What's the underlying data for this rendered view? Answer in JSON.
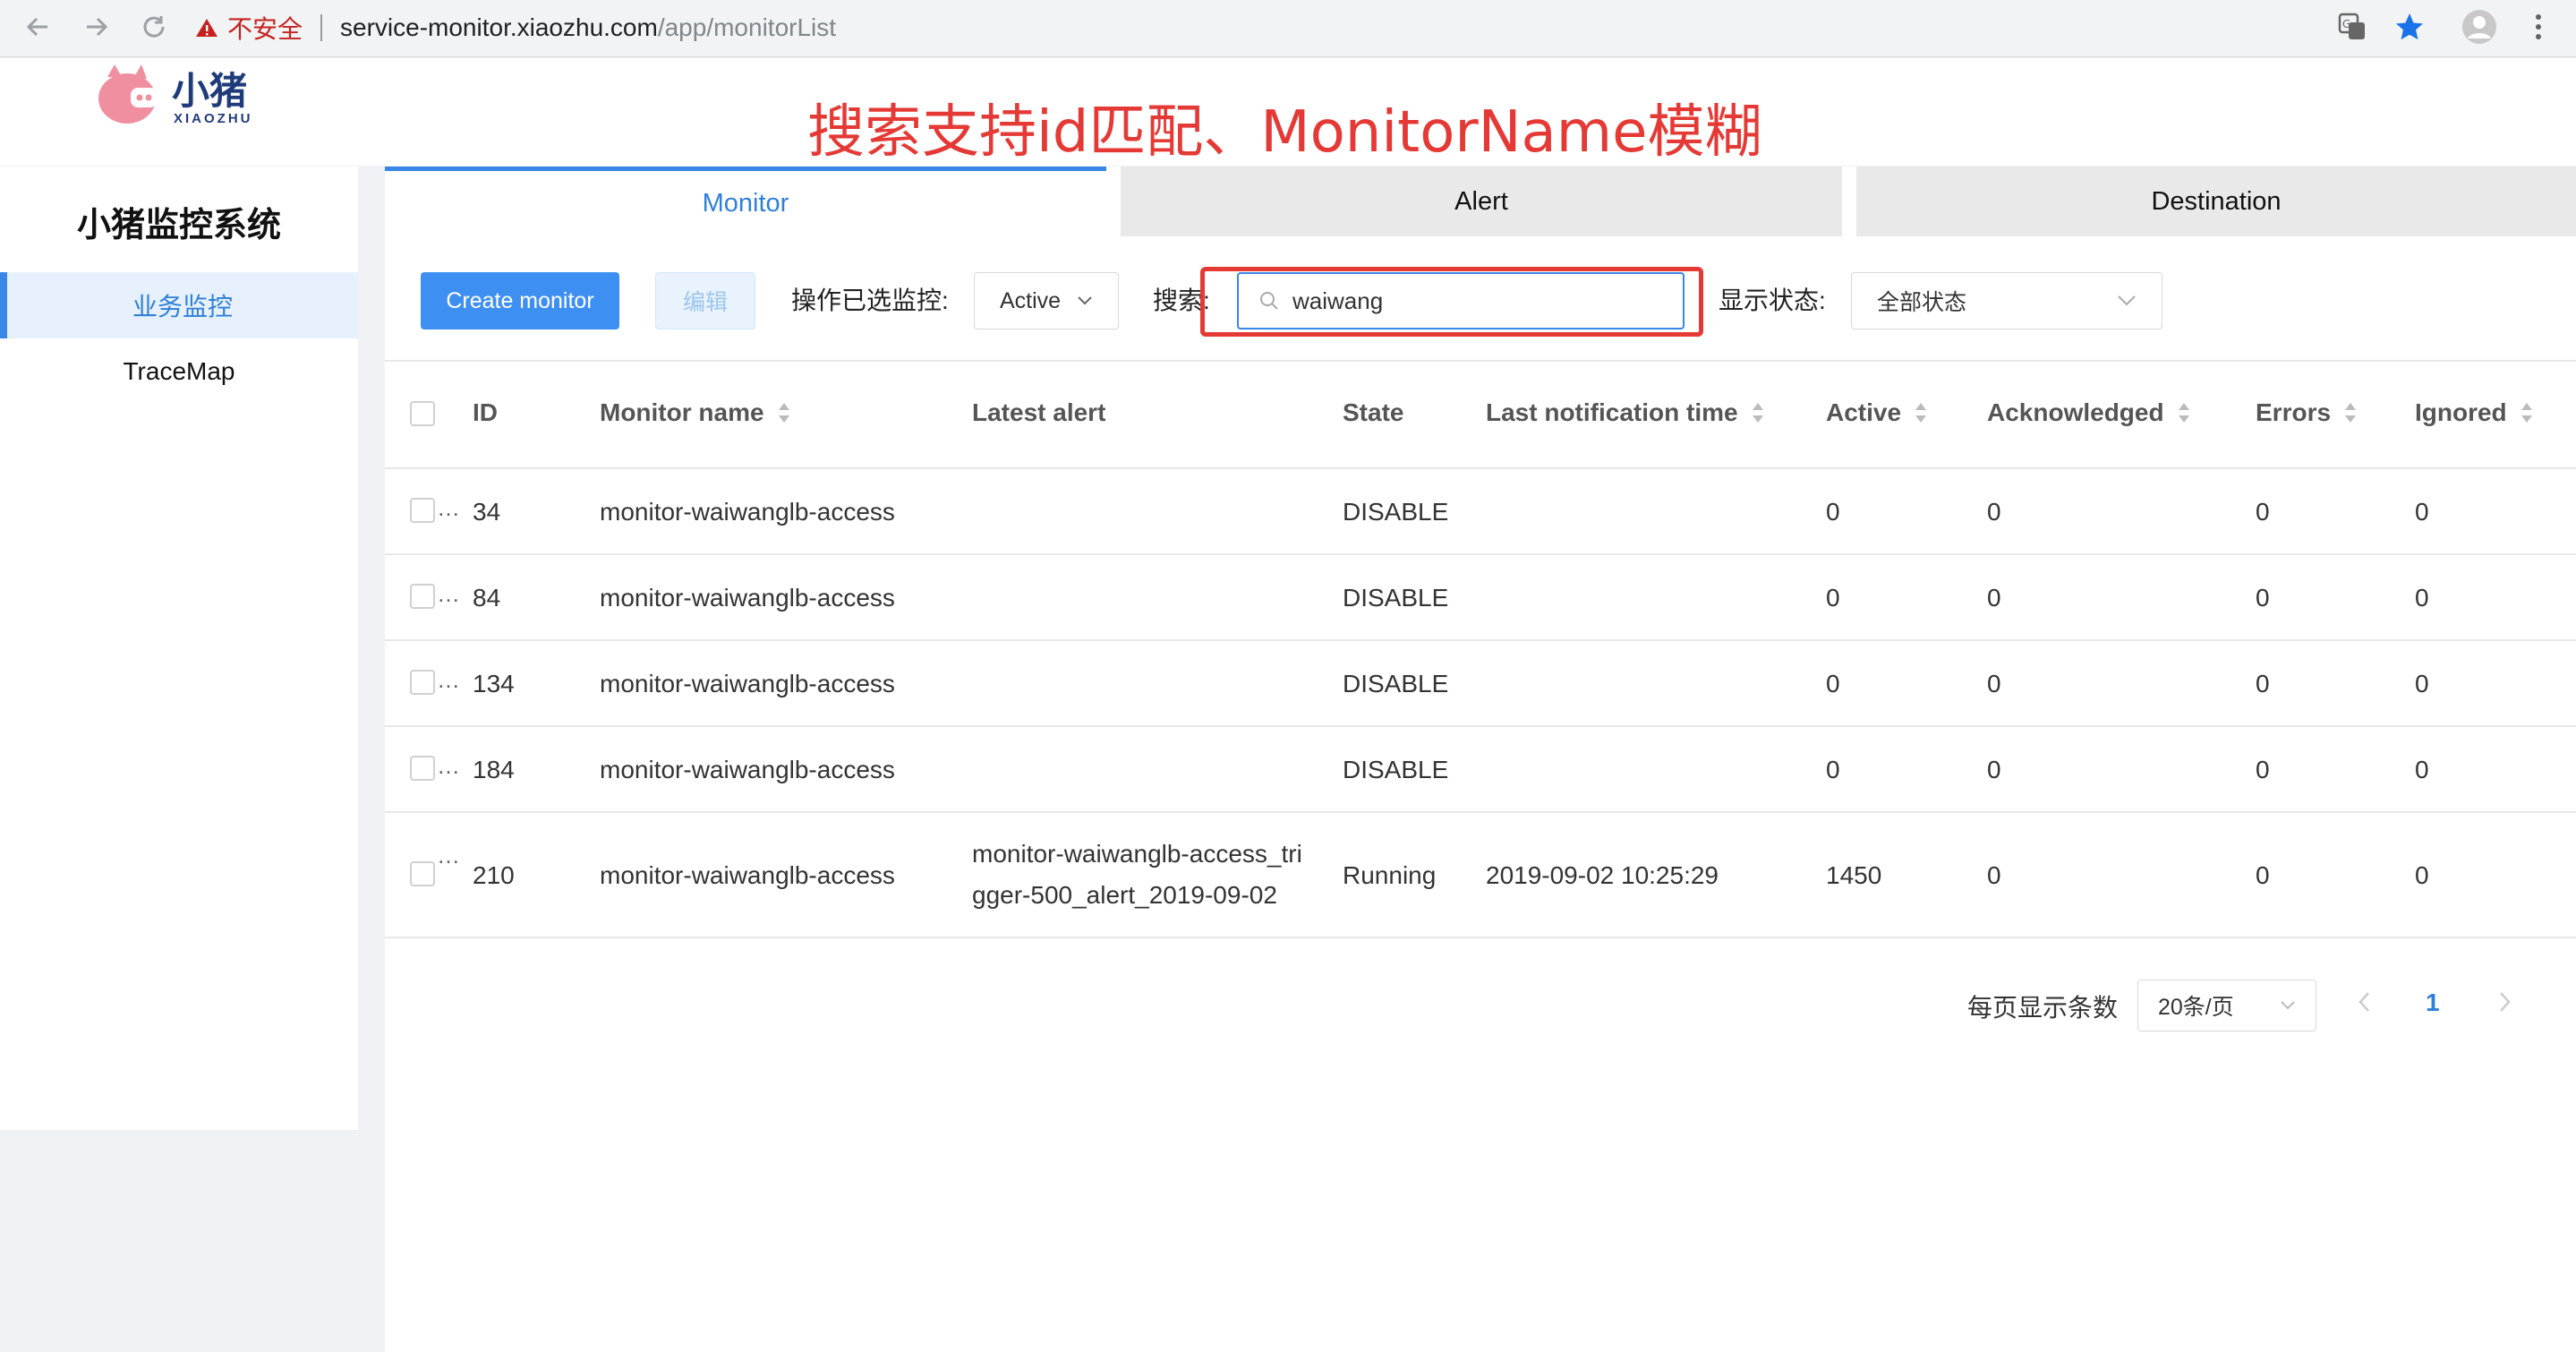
{
  "browser": {
    "security_label": "不安全",
    "url_host": "service-monitor.xiaozhu.com",
    "url_path": "/app/monitorList"
  },
  "logo": {
    "name": "小猪",
    "sub": "XIAOZHU"
  },
  "annotation": "搜索支持id匹配、MonitorName模糊",
  "sidebar": {
    "title": "小猪监控系统",
    "items": [
      {
        "label": "业务监控",
        "active": true
      },
      {
        "label": "TraceMap",
        "active": false
      }
    ]
  },
  "tabs": [
    {
      "label": "Monitor",
      "active": true
    },
    {
      "label": "Alert",
      "active": false
    },
    {
      "label": "Destination",
      "active": false
    }
  ],
  "toolbar": {
    "create_label": "Create monitor",
    "edit_label": "编辑",
    "bulk_label": "操作已选监控:",
    "bulk_value": "Active",
    "search_label": "搜索:",
    "search_value": "waiwang",
    "status_label": "显示状态:",
    "status_value": "全部状态"
  },
  "table": {
    "columns": [
      "ID",
      "Monitor name",
      "Latest alert",
      "State",
      "Last notification time",
      "Active",
      "Acknowledged",
      "Errors",
      "Ignored"
    ],
    "sortable": [
      true,
      true,
      false,
      false,
      true,
      true,
      true,
      true,
      true
    ],
    "rows": [
      {
        "id": "34",
        "name": "monitor-waiwanglb-access",
        "alert_line1": "",
        "alert_line2": "",
        "state": "DISABLE",
        "last_time": "",
        "active": "0",
        "ack": "0",
        "errors": "0",
        "ignored": "0"
      },
      {
        "id": "84",
        "name": "monitor-waiwanglb-access",
        "alert_line1": "",
        "alert_line2": "",
        "state": "DISABLE",
        "last_time": "",
        "active": "0",
        "ack": "0",
        "errors": "0",
        "ignored": "0"
      },
      {
        "id": "134",
        "name": "monitor-waiwanglb-access",
        "alert_line1": "",
        "alert_line2": "",
        "state": "DISABLE",
        "last_time": "",
        "active": "0",
        "ack": "0",
        "errors": "0",
        "ignored": "0"
      },
      {
        "id": "184",
        "name": "monitor-waiwanglb-access",
        "alert_line1": "",
        "alert_line2": "",
        "state": "DISABLE",
        "last_time": "",
        "active": "0",
        "ack": "0",
        "errors": "0",
        "ignored": "0"
      },
      {
        "id": "210",
        "name": "monitor-waiwanglb-access",
        "alert_line1": "monitor-waiwanglb-access_tri",
        "alert_line2": "gger-500_alert_2019-09-02",
        "state": "Running",
        "last_time": "2019-09-02 10:25:29",
        "active": "1450",
        "ack": "0",
        "errors": "0",
        "ignored": "0"
      }
    ]
  },
  "pagination": {
    "per_page_label": "每页显示条数",
    "per_page_value": "20条/页",
    "current_page": "1"
  },
  "colors": {
    "primary": "#3d8ff2",
    "annotation": "#e53935",
    "highlight_box": "#e53935"
  }
}
